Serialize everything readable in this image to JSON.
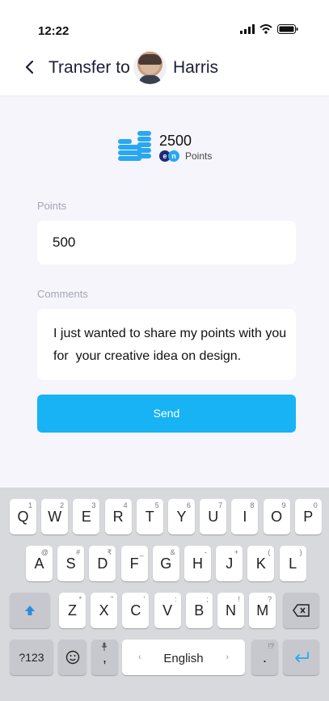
{
  "status": {
    "time": "12:22"
  },
  "header": {
    "title": "Transfer to",
    "name": "Harris"
  },
  "balance": {
    "amount": "2500",
    "badge_left": "e",
    "badge_right": "n",
    "unit": "Points"
  },
  "form": {
    "points_label": "Points",
    "points_value": "500",
    "comments_label": "Comments",
    "comments_value": "I just wanted to share my points with you\nfor  your creative idea on design.",
    "send_label": "Send"
  },
  "keyboard": {
    "row1": [
      [
        "Q",
        "1"
      ],
      [
        "W",
        "2"
      ],
      [
        "E",
        "3"
      ],
      [
        "R",
        "4"
      ],
      [
        "T",
        "5"
      ],
      [
        "Y",
        "6"
      ],
      [
        "U",
        "7"
      ],
      [
        "I",
        "8"
      ],
      [
        "O",
        "9"
      ],
      [
        "P",
        "0"
      ]
    ],
    "row2": [
      [
        "A",
        "@"
      ],
      [
        "S",
        "#"
      ],
      [
        "D",
        "₹"
      ],
      [
        "F",
        "_"
      ],
      [
        "G",
        "&"
      ],
      [
        "H",
        "-"
      ],
      [
        "J",
        "+"
      ],
      [
        "K",
        "("
      ],
      [
        "L",
        ")"
      ]
    ],
    "row3": [
      [
        "Z",
        "*"
      ],
      [
        "X",
        "\""
      ],
      [
        "C",
        "'"
      ],
      [
        "V",
        ":"
      ],
      [
        "B",
        ";"
      ],
      [
        "N",
        "!"
      ],
      [
        "M",
        "?"
      ]
    ],
    "sym_label": "?123",
    "comma": ",",
    "space_label": "English",
    "period": ".",
    "period_hint": "!?"
  },
  "colors": {
    "accent": "#17b3f5",
    "background": "#f5f5fb",
    "coin": "#2aa7f1"
  }
}
